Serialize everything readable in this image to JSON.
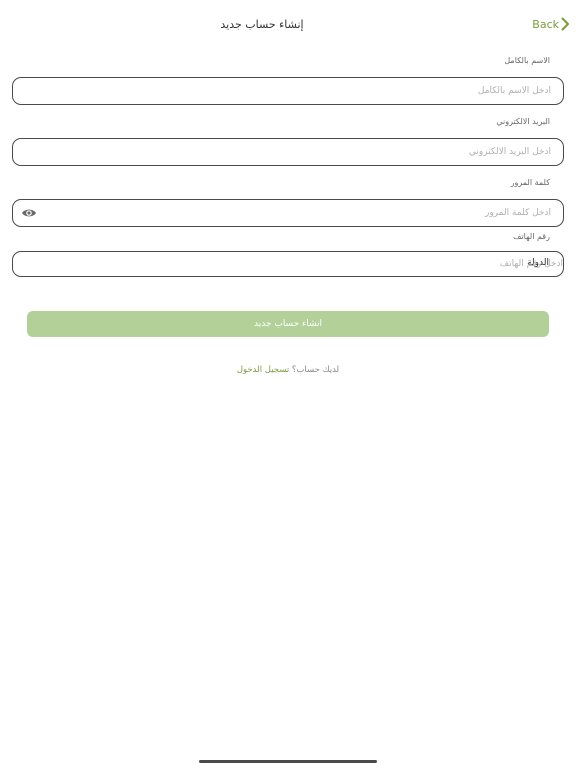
{
  "nav": {
    "back_label": "Back",
    "title": "إنشاء حساب جديد"
  },
  "form": {
    "full_name": {
      "label": "الاسم بالكامل",
      "placeholder": "ادخل الاسم بالكامل",
      "value": ""
    },
    "email": {
      "label": "البريد الالكتروني",
      "placeholder": "ادخل البريد الالكتروني",
      "value": ""
    },
    "password": {
      "label": "كلمة المرور",
      "placeholder": "ادخل كلمة المرور",
      "value": "",
      "toggle_icon": "eye-icon"
    },
    "phone": {
      "label": "رقم الهاتف",
      "country_label": "الدولة",
      "placeholder": "ادخل رقم الهاتف",
      "value": ""
    },
    "submit_label": "انشاء حساب جديد"
  },
  "login_prompt": {
    "question": "لديك حساب؟",
    "link_label": "تسجيل الدخول"
  },
  "colors": {
    "accent": "#7b9a3c",
    "button_bg": "#b2d097",
    "border": "#4a4a4a"
  }
}
